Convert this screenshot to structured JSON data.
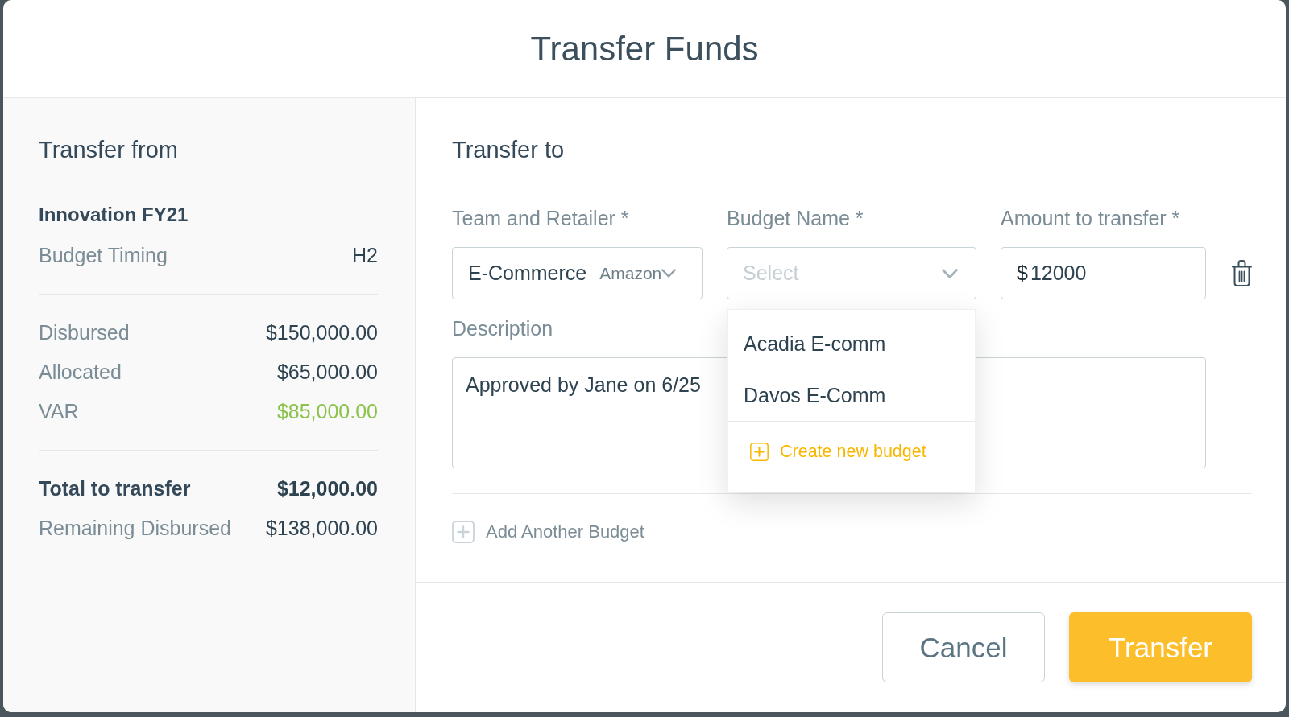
{
  "dialog": {
    "title": "Transfer Funds"
  },
  "transfer_from": {
    "heading": "Transfer from",
    "budget": "Innovation FY21",
    "sections": [
      {
        "rows": [
          {
            "label": "Budget Timing",
            "value": "H2",
            "kind": "plain"
          }
        ]
      },
      {
        "rows": [
          {
            "label": "Disbursed",
            "value": "$150,000.00",
            "kind": "plain"
          },
          {
            "label": "Allocated",
            "value": "$65,000.00",
            "kind": "plain"
          },
          {
            "label": "VAR",
            "value": "$85,000.00",
            "kind": "positive"
          }
        ]
      },
      {
        "rows": [
          {
            "label": "Total to transfer",
            "value": "$12,000.00",
            "kind": "total"
          },
          {
            "label": "Remaining Disbursed",
            "value": "$138,000.00",
            "kind": "plain"
          }
        ]
      }
    ]
  },
  "transfer_to": {
    "heading": "Transfer to",
    "team_retailer": {
      "label": "Team and Retailer *",
      "value": "E-Commerce",
      "retailer": "Amazon"
    },
    "budget_name": {
      "label": "Budget Name *",
      "placeholder": "Select",
      "expanded": true,
      "options": [
        {
          "label": "Acadia E-comm",
          "selected": false
        },
        {
          "label": "Davos E-Comm",
          "selected": false
        }
      ],
      "create_action": "Create new budget"
    },
    "amount": {
      "label": "Amount to transfer *",
      "currency": "$",
      "value": "12000"
    },
    "description": {
      "label": "Description",
      "value": "Approved by Jane on 6/25"
    },
    "add_action": "Add Another Budget"
  },
  "buttons": [
    {
      "label": "Cancel",
      "kind": "secondary"
    },
    {
      "label": "Transfer",
      "kind": "primary"
    }
  ]
}
